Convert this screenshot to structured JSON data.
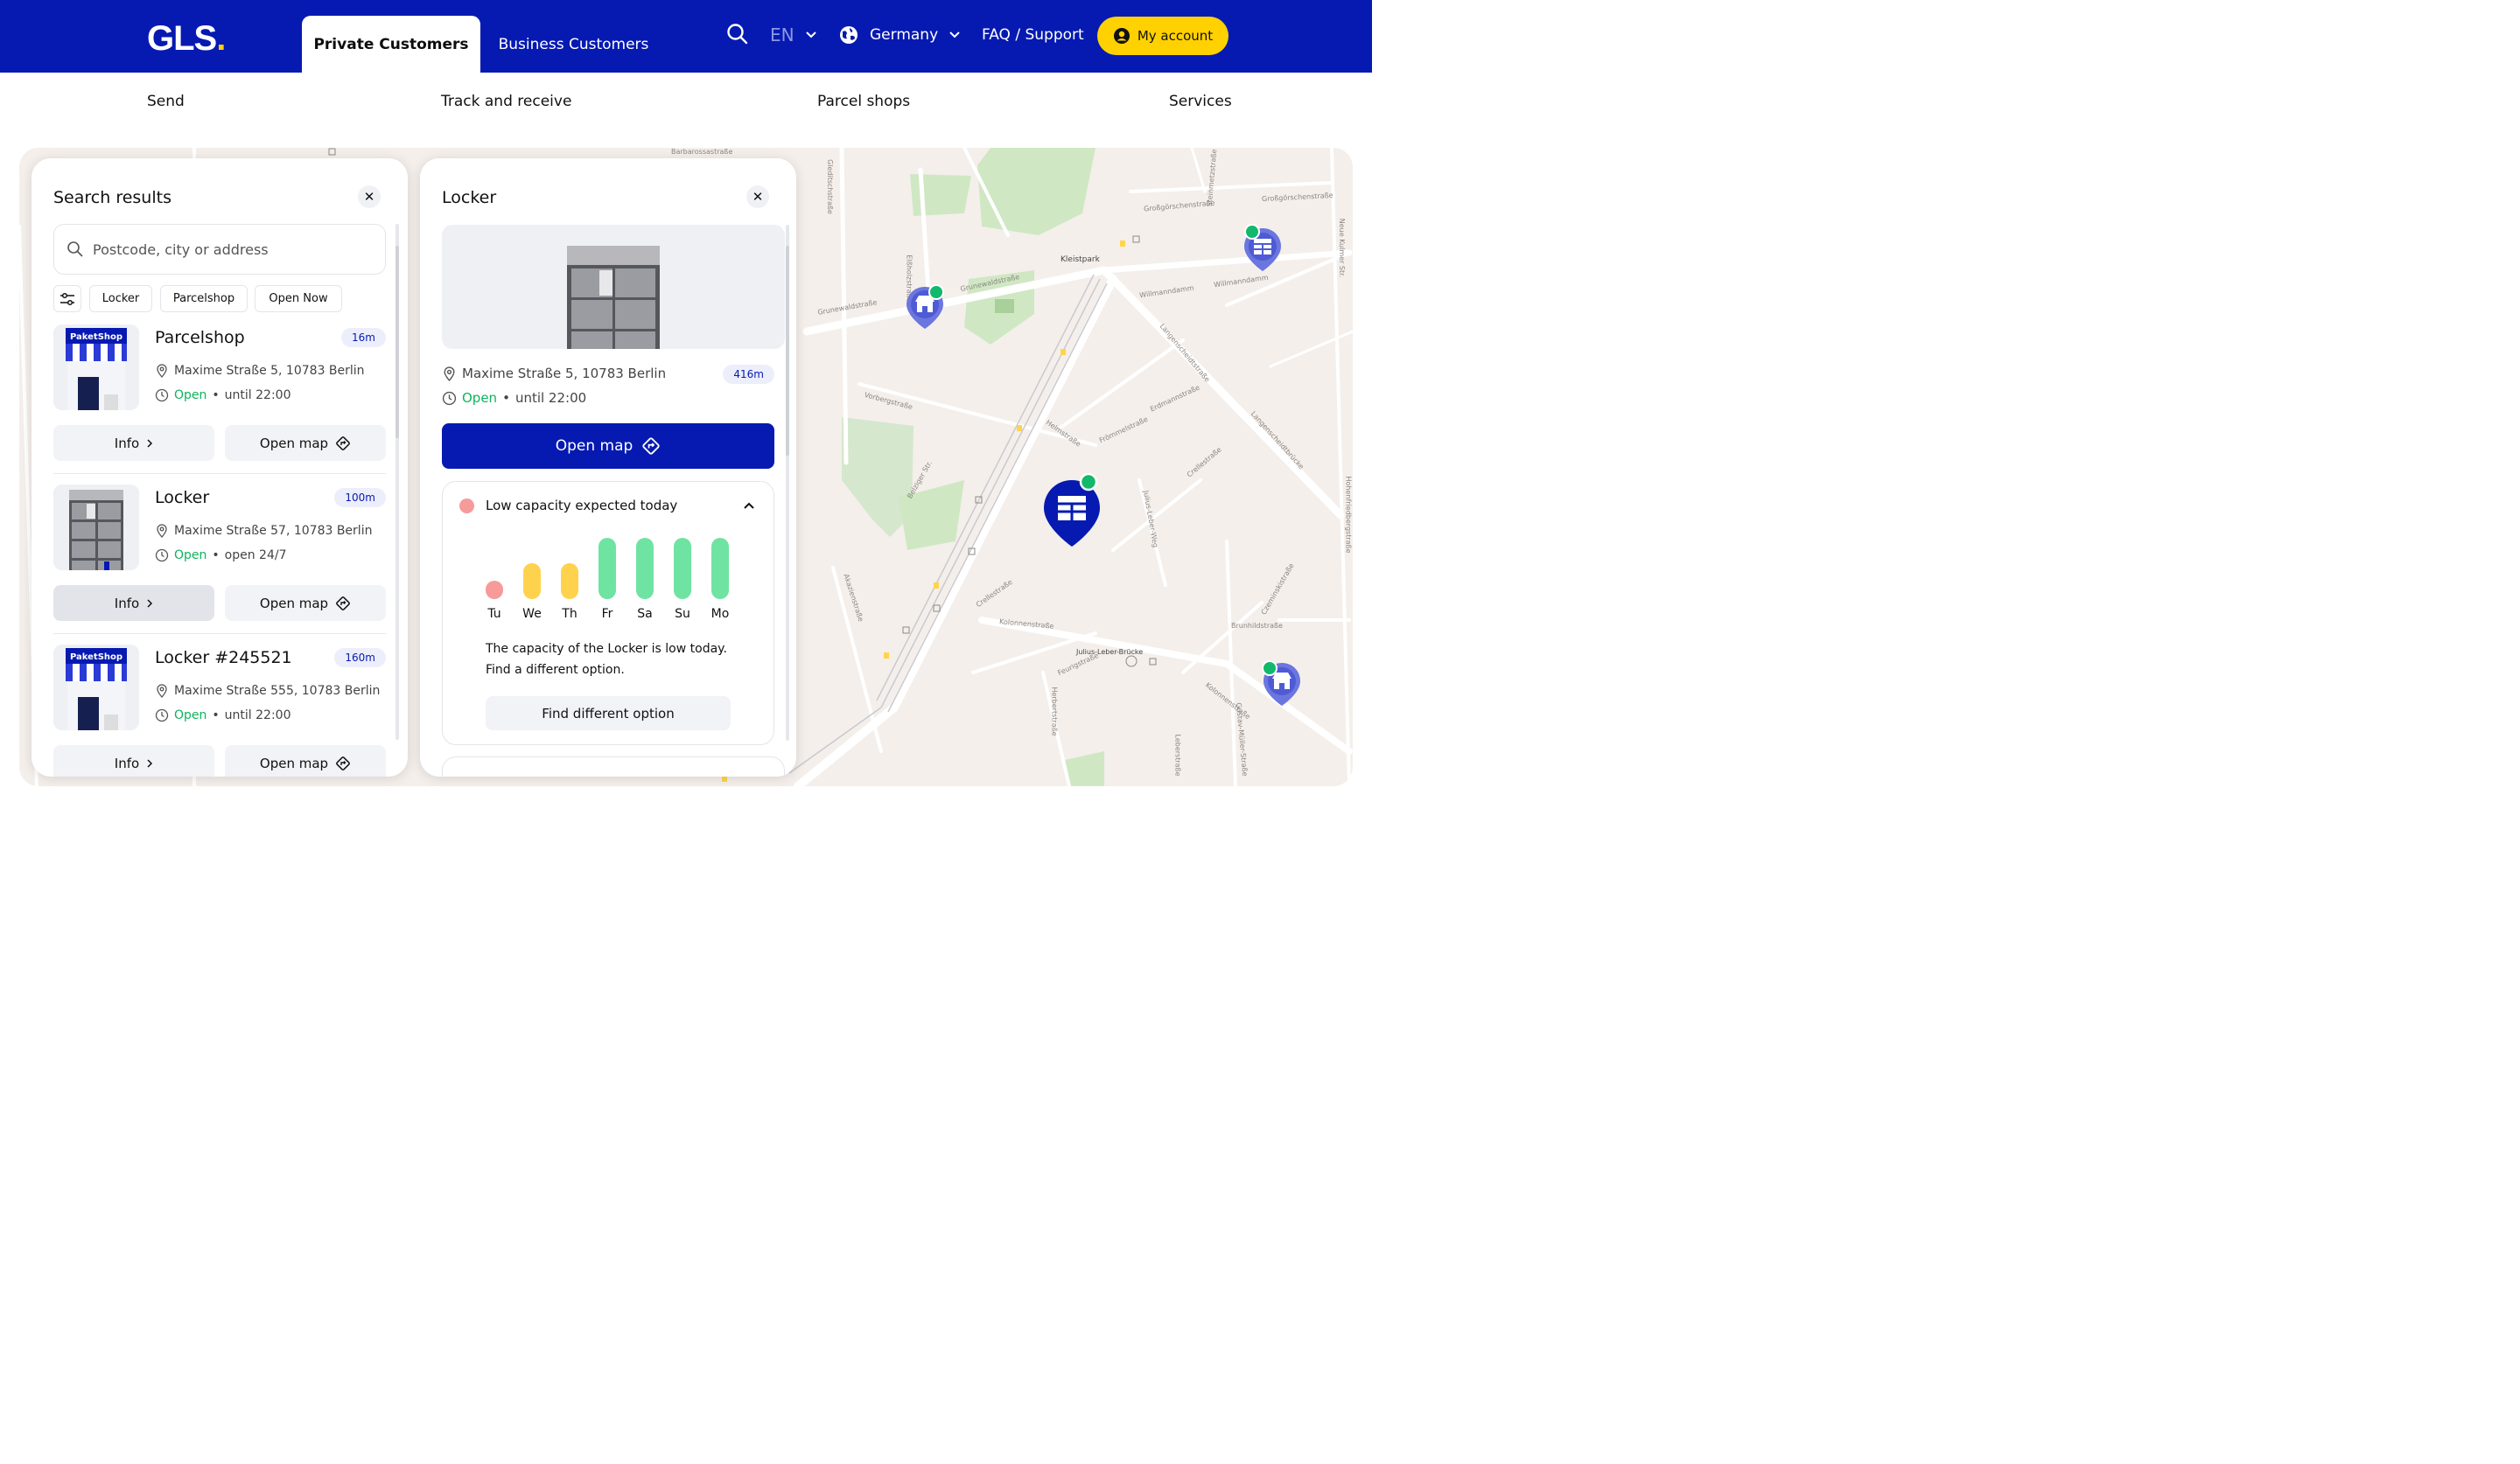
{
  "header": {
    "logo_text": "GLS",
    "logo_dot": ".",
    "tabs": [
      {
        "label": "Private Customers",
        "active": true
      },
      {
        "label": "Business Customers",
        "active": false
      }
    ],
    "language": "EN",
    "country": "Germany",
    "faq": "FAQ / Support",
    "account": "My account",
    "colors": {
      "brand_blue": "#061ab1",
      "brand_yellow": "#ffd100"
    }
  },
  "subnav": [
    "Send",
    "Track and receive",
    "Parcel shops",
    "Services"
  ],
  "search_panel": {
    "title": "Search results",
    "placeholder": "Postcode, city or address",
    "filters": [
      "Locker",
      "Parcelshop",
      "Open Now"
    ],
    "results": [
      {
        "name": "Parcelshop",
        "distance": "16m",
        "address": "Maxime Straße 5, 10783 Berlin",
        "status": "Open",
        "hours": "until 22:00",
        "thumb": "parcelshop",
        "thumb_label": "PaketShop",
        "info": "Info",
        "map": "Open map"
      },
      {
        "name": "Locker",
        "distance": "100m",
        "address": "Maxime Straße 57, 10783 Berlin",
        "status": "Open",
        "hours": "open 24/7",
        "thumb": "locker",
        "info": "Info",
        "map": "Open map"
      },
      {
        "name": "Locker #245521",
        "distance": "160m",
        "address": "Maxime Straße 555, 10783 Berlin",
        "status": "Open",
        "hours": "until 22:00",
        "thumb": "parcelshop",
        "thumb_label": "PaketShop",
        "info": "Info",
        "map": "Open map"
      }
    ]
  },
  "detail_panel": {
    "title": "Locker",
    "address": "Maxime Straße 5, 10783 Berlin",
    "distance": "416m",
    "status": "Open",
    "hours": "until 22:00",
    "open_map": "Open map",
    "capacity": {
      "heading": "Low capacity expected today",
      "days": [
        {
          "day": "Tu",
          "level": 0.05,
          "color": "#f79a9a"
        },
        {
          "day": "We",
          "level": 0.45,
          "color": "#ffd24d"
        },
        {
          "day": "Th",
          "level": 0.45,
          "color": "#ffd24d"
        },
        {
          "day": "Fr",
          "level": 1.0,
          "color": "#6fe3a2"
        },
        {
          "day": "Sa",
          "level": 1.0,
          "color": "#6fe3a2"
        },
        {
          "day": "Su",
          "level": 1.0,
          "color": "#6fe3a2"
        },
        {
          "day": "Mo",
          "level": 1.0,
          "color": "#6fe3a2"
        }
      ],
      "message_1": "The capacity of the Locker is low today.",
      "message_2": "Find a different option.",
      "button": "Find different option"
    }
  },
  "map": {
    "streets": [
      "Barbarossastraße",
      "Grunewaldstraße",
      "Grunewaldstraße",
      "Großgörschenstraße",
      "Großgörschenstraße",
      "Kleistpark",
      "Willmanndamm",
      "Willmanndamm",
      "Langenscheidtstraße",
      "Langenscheidtbrücke",
      "Erdmannstraße",
      "Crellestraße",
      "Crellestraße",
      "Vorbergstraße",
      "Helmstraße",
      "Frömmelstraße",
      "Kolonnenstraße",
      "Kolonnenstraße",
      "Julius-Leber-Brücke",
      "Feurigstraße",
      "Brunhildstraße",
      "Akazienstraße",
      "Gleditschstraße",
      "Elßholzstraße",
      "Hohenfriedbergstraße",
      "Czeminskistraße",
      "Leberstraße",
      "Herbertstraße",
      "Gustav-Müller-Straße",
      "Steinmetzstraße",
      "Neue Kulmer Str.",
      "Belziger Str.",
      "Julius-Leber-Weg"
    ]
  }
}
